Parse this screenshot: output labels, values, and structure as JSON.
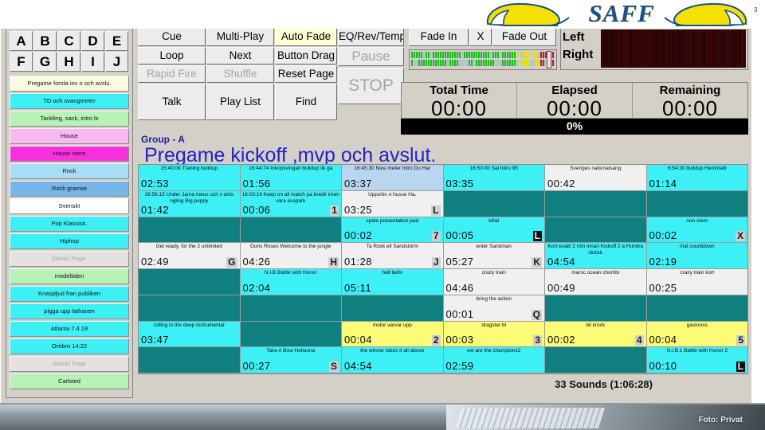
{
  "header": {
    "brand": "SAFF",
    "page_number": "3",
    "logo_left_icon": "helmet-icon",
    "logo_right_icon": "helmet-icon"
  },
  "left_panel": {
    "alpha_buttons": [
      [
        "A",
        "B",
        "C",
        "D",
        "E"
      ],
      [
        "F",
        "G",
        "H",
        "I",
        "J"
      ]
    ],
    "cue_items": [
      {
        "label": "Pregame forsta inv o och avslu.",
        "color": "#fbfbe0",
        "dim": false
      },
      {
        "label": "TD och svangmeter",
        "color": "#3df0f5",
        "dim": false
      },
      {
        "label": "Tackling, sack, intro ls",
        "color": "#b7f2b7",
        "dim": false
      },
      {
        "label": "House",
        "color": "#f9b8ef",
        "dim": false
      },
      {
        "label": "House varre",
        "color": "#f930de",
        "dim": false
      },
      {
        "label": "Rock",
        "color": "#a9dcf5",
        "dim": false
      },
      {
        "label": "Rock gramse",
        "color": "#77b6ea",
        "dim": false
      },
      {
        "label": "Svenskt",
        "color": "#ffffff",
        "dim": false
      },
      {
        "label": "Pop Klassisk.",
        "color": "#3df0f5",
        "dim": false
      },
      {
        "label": "Hiphop",
        "color": "#3df0f5",
        "dim": false
      },
      {
        "label": "(blank) Page.",
        "color": "#e4e2de",
        "dim": true
      },
      {
        "label": "medeltiden",
        "color": "#b7f2b7",
        "dim": false
      },
      {
        "label": "Knaspljud fran publiken",
        "color": "#3df0f5",
        "dim": false
      },
      {
        "label": "pigga upp lathaven",
        "color": "#3df0f5",
        "dim": false
      },
      {
        "label": "Atlanta 7.4.18",
        "color": "#3df0f5",
        "dim": false
      },
      {
        "label": "Orebro 14:22",
        "color": "#3df0f5",
        "dim": false
      },
      {
        "label": "(blank) Page",
        "color": "#e4e2de",
        "dim": true
      },
      {
        "label": "Carlsted",
        "color": "#b7f2b7",
        "dim": false
      }
    ]
  },
  "toolbar": {
    "col1": [
      {
        "label": "Cue",
        "dim": false,
        "highlight": false
      },
      {
        "label": "Loop",
        "dim": false,
        "highlight": false
      },
      {
        "label": "Rapid Fire",
        "dim": true,
        "highlight": false
      },
      {
        "label": "Talk",
        "dim": false,
        "highlight": false
      }
    ],
    "col2": [
      {
        "label": "Multi-Play",
        "dim": false,
        "highlight": false
      },
      {
        "label": "Next",
        "dim": false,
        "highlight": false
      },
      {
        "label": "Shuffle",
        "dim": true,
        "highlight": false
      },
      {
        "label": "Play List",
        "dim": false,
        "highlight": false
      }
    ],
    "col3": [
      {
        "label": "Auto Fade",
        "dim": false,
        "highlight": true
      },
      {
        "label": "Button Drag",
        "dim": false,
        "highlight": false
      },
      {
        "label": "Reset Page",
        "dim": false,
        "highlight": false
      },
      {
        "label": "Find",
        "dim": false,
        "highlight": false
      }
    ],
    "eq_label": "EQ/Rev/Temp",
    "pause_label": "Pause",
    "stop_label": "STOP",
    "fade_in_label": "Fade In",
    "fade_x_label": "X",
    "fade_out_label": "Fade Out"
  },
  "meters": {
    "left_label": "Left",
    "right_label": "Right"
  },
  "time_panels": [
    {
      "title": "Total Time",
      "value": "00:00"
    },
    {
      "title": "Elapsed",
      "value": "00:00"
    },
    {
      "title": "Remaining",
      "value": "00:00"
    }
  ],
  "progress": {
    "percent_label": "0%",
    "percent": 0
  },
  "group": {
    "label": "Group - A",
    "title": "Pregame  kickoff ,mvp och avslut."
  },
  "status": {
    "text": "33 Sounds (1:06:28)"
  },
  "photo": {
    "credit": "Foto: Privat"
  },
  "colors": {
    "cell_cyan": "#3df0f5",
    "cell_teal": "#0f7f7f",
    "cell_white": "#f0f0f0",
    "cell_yellow": "#fbfb78",
    "cell_lightblue": "#b9d6f0",
    "accent_blue": "#2222cc",
    "highlight_yellow": "#ffffd6"
  },
  "grid": {
    "columns": 6,
    "rows": 8,
    "cells": [
      [
        {
          "name": "15:40:08 Traning buildup",
          "time": "02:53",
          "badge": "",
          "color": "#3df0f5"
        },
        {
          "name": "16:44:74 Inkopsvingan buildup ilk ga",
          "time": "01:56",
          "badge": "",
          "color": "#3df0f5"
        },
        {
          "name": "16:45:30 Nice meter Intro Du Har",
          "time": "03:37",
          "badge": "",
          "color": "#b9d6f0"
        },
        {
          "name": "16:50:00 Sal Intro 95",
          "time": "03:35",
          "badge": "",
          "color": "#3df0f5"
        },
        {
          "name": "Sveriges nationalsang",
          "time": "00:42",
          "badge": "",
          "color": "#f0f0f0"
        },
        {
          "name": "6:54:30 buildup Hemmalit",
          "time": "01:14",
          "badge": "",
          "color": "#3df0f5"
        }
      ],
      [
        {
          "name": "16:56:15 Under Jama meus och s ants ngling Big puppy",
          "time": "01:42",
          "badge": "",
          "color": "#3df0f5"
        },
        {
          "name": "16:03:19 Keep on all match pa bredk imen vara avspark",
          "time": "00:06",
          "badge": "1",
          "color": "#3df0f5"
        },
        {
          "name": "Uppshin o husse Ha.",
          "time": "03:25",
          "badge": "L",
          "color": "#f0f0f0"
        },
        {
          "name": "",
          "time": "",
          "badge": "",
          "color": "#0f7f7f"
        },
        {
          "name": "",
          "time": "",
          "badge": "",
          "color": "#0f7f7f"
        },
        {
          "name": "",
          "time": "",
          "badge": "",
          "color": "#0f7f7f"
        }
      ],
      [
        {
          "name": "",
          "time": "",
          "badge": "",
          "color": "#0f7f7f"
        },
        {
          "name": "",
          "time": "",
          "badge": "",
          "color": "#0f7f7f"
        },
        {
          "name": "spela presentation pad",
          "time": "00:02",
          "badge": "7",
          "color": "#3df0f5"
        },
        {
          "name": "killat",
          "time": "00:05",
          "badge": "L",
          "color": "#3df0f5",
          "badge_black": true
        },
        {
          "name": "",
          "time": "",
          "badge": "",
          "color": "#0f7f7f"
        },
        {
          "name": "non stem",
          "time": "00:02",
          "badge": "X",
          "color": "#3df0f5"
        }
      ],
      [
        {
          "name": "Get ready, for the 2 unlimited",
          "time": "02:49",
          "badge": "G",
          "color": "#f0f0f0"
        },
        {
          "name": "Guns Roses Welcome to the jungle",
          "time": "04:26",
          "badge": "H",
          "color": "#f0f0f0"
        },
        {
          "name": "Ta Rock ell Sandstorm",
          "time": "01:28",
          "badge": "J",
          "color": "#f0f0f0"
        },
        {
          "name": "enter Sandman",
          "time": "05:27",
          "badge": "K",
          "color": "#f0f0f0"
        },
        {
          "name": "Kort exakt 2 min innan Kickoff 2 a Hundra slutick",
          "time": "04:54",
          "badge": "",
          "color": "#3df0f5"
        },
        {
          "name": "mal countdown",
          "time": "02:19",
          "badge": "",
          "color": "#3df0f5"
        }
      ],
      [
        {
          "name": "",
          "time": "",
          "badge": "",
          "color": "#0f7f7f"
        },
        {
          "name": "N.I.B Battle with Honor",
          "time": "02:04",
          "badge": "",
          "color": "#3df0f5"
        },
        {
          "name": "hell bells",
          "time": "05:11",
          "badge": "",
          "color": "#3df0f5"
        },
        {
          "name": "crazy train",
          "time": "04:46",
          "badge": "",
          "color": "#f0f0f0"
        },
        {
          "name": "marsc ocean chombi",
          "time": "00:49",
          "badge": "",
          "color": "#f0f0f0"
        },
        {
          "name": "crazy train kort",
          "time": "00:25",
          "badge": "",
          "color": "#f0f0f0"
        }
      ],
      [
        {
          "name": "",
          "time": "",
          "badge": "",
          "color": "#0f7f7f"
        },
        {
          "name": "",
          "time": "",
          "badge": "",
          "color": "#0f7f7f"
        },
        {
          "name": "",
          "time": "",
          "badge": "",
          "color": "#0f7f7f"
        },
        {
          "name": "bring the action",
          "time": "00:01",
          "badge": "Q",
          "color": "#f0f0f0"
        },
        {
          "name": "",
          "time": "",
          "badge": "",
          "color": "#0f7f7f"
        },
        {
          "name": "",
          "time": "",
          "badge": "",
          "color": "#0f7f7f"
        }
      ],
      [
        {
          "name": "rolling in the deep instrumental",
          "time": "03:47",
          "badge": "",
          "color": "#3df0f5"
        },
        {
          "name": "",
          "time": "",
          "badge": "",
          "color": "#0f7f7f"
        },
        {
          "name": "motor varvar upp",
          "time": "00:04",
          "badge": "2",
          "color": "#fbfb78"
        },
        {
          "name": "dragster bl",
          "time": "00:03",
          "badge": "3",
          "color": "#fbfb78"
        },
        {
          "name": "bil krock",
          "time": "00:02",
          "badge": "4",
          "color": "#fbfb78"
        },
        {
          "name": "gaskross",
          "time": "00:04",
          "badge": "5",
          "color": "#fbfb78"
        }
      ],
      [
        {
          "name": "",
          "time": "",
          "badge": "",
          "color": "#0f7f7f"
        },
        {
          "name": "Take A Bow Hellanna",
          "time": "00:27",
          "badge": "S",
          "color": "#3df0f5"
        },
        {
          "name": "the winner takes it all above",
          "time": "04:54",
          "badge": "",
          "color": "#3df0f5"
        },
        {
          "name": "we are the champions2",
          "time": "02:59",
          "badge": "",
          "color": "#3df0f5"
        },
        {
          "name": "",
          "time": "",
          "badge": "",
          "color": "#0f7f7f"
        },
        {
          "name": "N.I.B.1 Battle with Honor 2",
          "time": "00:10",
          "badge": "L",
          "color": "#3df0f5",
          "badge_black": true
        }
      ]
    ]
  }
}
